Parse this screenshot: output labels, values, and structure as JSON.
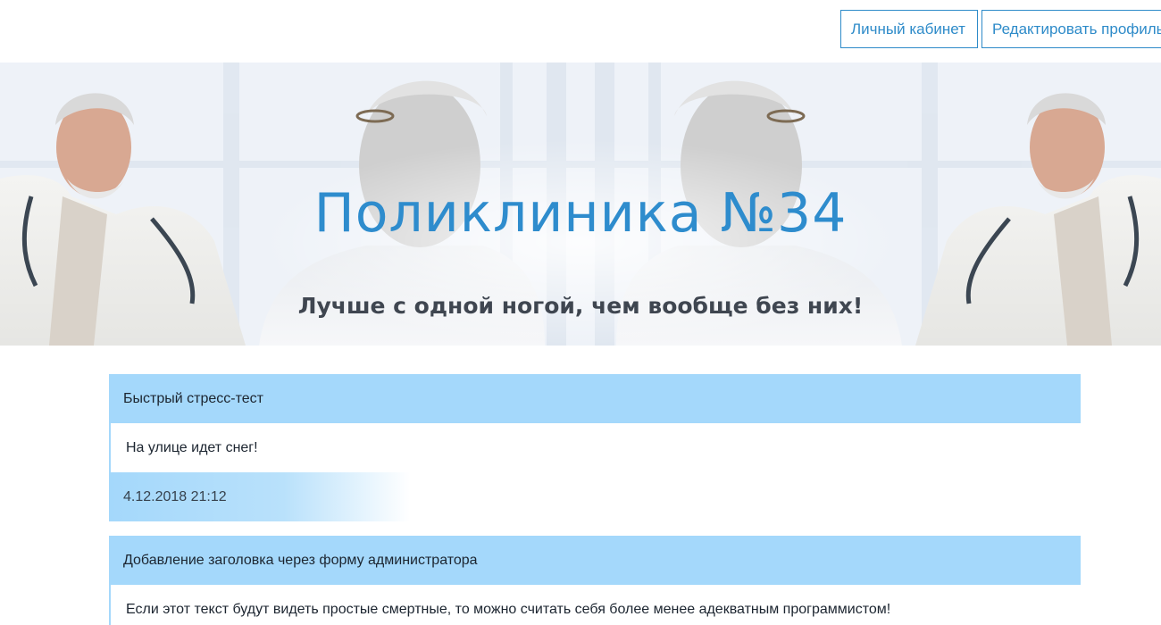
{
  "nav": {
    "cabinet_label": "Личный кабинет",
    "edit_profile_label": "Редактировать профиль"
  },
  "hero": {
    "title": "Поликлиника №34",
    "subtitle": "Лучше с одной ногой, чем вообще без них!"
  },
  "news": [
    {
      "title": "Быстрый стресс-тест",
      "body": "На улице идет снег!",
      "date": "4.12.2018 21:12"
    },
    {
      "title": "Добавление заголовка через форму администратора",
      "body": "Если этот текст будут видеть простые смертные, то можно считать себя более менее адекватным программистом!"
    }
  ],
  "colors": {
    "accent": "#2e8ccd",
    "card_header": "#a4d8fb",
    "subtitle": "#3f4650"
  }
}
